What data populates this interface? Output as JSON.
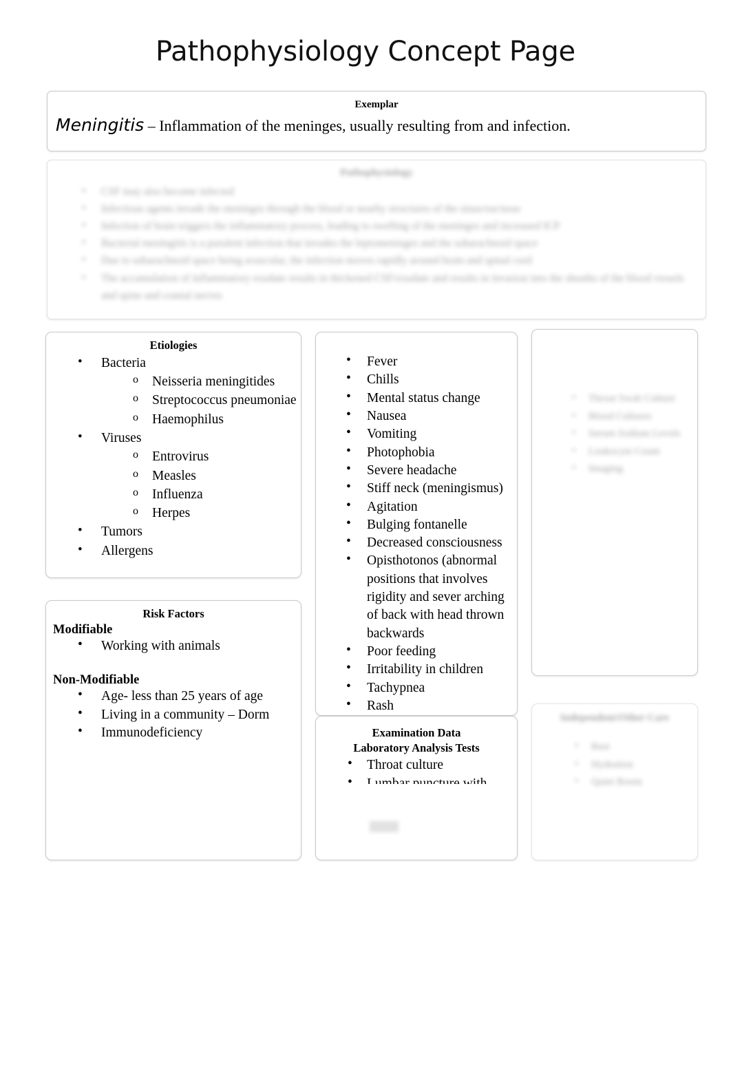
{
  "page": {
    "title": "Pathophysiology Concept Page"
  },
  "exemplar": {
    "label": "Exemplar",
    "term": "Meningitis",
    "definition": "– Inflammation of the meninges, usually resulting from and infection."
  },
  "pathophysiology": {
    "title": "Pathophysiology",
    "items": [
      "CSF may also become infected",
      "Infectious agents invade the meninges through the blood or nearby structures of the sinus/ear/nose",
      "Infection of brain triggers the inflammatory process, leading to swelling of the meninges and increased ICP",
      "Bacterial meningitis is a purulent infection that invades the leptomeninges and the subarachnoid space",
      "Due to subarachnoid space being avascular, the infection moves rapidly around brain and spinal cord",
      "The accumulation of inflammatory exudate results in thickened CSF/exudate and results in invasion into the sheaths of the blood vessels and spine and cranial nerves"
    ]
  },
  "etiologies": {
    "title": "Etiologies",
    "items": [
      {
        "label": "Bacteria",
        "children": [
          "Neisseria meningitides",
          "Streptococcus pneumoniae",
          "Haemophilus"
        ]
      },
      {
        "label": "Viruses",
        "children": [
          "Entrovirus",
          "Measles",
          "Influenza",
          "Herpes"
        ]
      },
      {
        "label": "Tumors",
        "children": []
      },
      {
        "label": "Allergens",
        "children": []
      }
    ]
  },
  "risk_factors": {
    "title": "Risk Factors",
    "modifiable_heading": "Modifiable",
    "modifiable": [
      "Working with animals"
    ],
    "non_modifiable_heading": "Non-Modifiable",
    "non_modifiable": [
      "Age- less than 25 years of age",
      "Living in a community – Dorm",
      "Immunodeficiency"
    ]
  },
  "symptoms": {
    "items": [
      "Fever",
      "Chills",
      "Mental status change",
      "Nausea",
      "Vomiting",
      "Photophobia",
      "Severe headache",
      "Stiff neck (meningismus)",
      "Agitation",
      "Bulging fontanelle",
      "Decreased consciousness",
      "Opisthotonos (abnormal positions that involves rigidity and sever arching of back with head thrown backwards",
      "Poor feeding",
      "Irritability in children",
      "Tachypnea",
      "Rash"
    ]
  },
  "examination_data": {
    "title": "Examination Data",
    "subtitle": "Laboratory Analysis Tests",
    "items": [
      "Throat culture",
      "Lumbar puncture with"
    ]
  },
  "right_top": {
    "items": [
      "Throat Swab Culture",
      "Blood Cultures",
      "Serum Sodium Levels",
      "Leukocyte Count",
      "Imaging"
    ]
  },
  "right_bottom": {
    "title": "Independent/Other Care",
    "items": [
      "Rest",
      "Hydration",
      "Quiet Room"
    ]
  },
  "colors": {
    "text": "#000000",
    "panel_border": "#c9c9c9",
    "page_background": "#ffffff"
  }
}
